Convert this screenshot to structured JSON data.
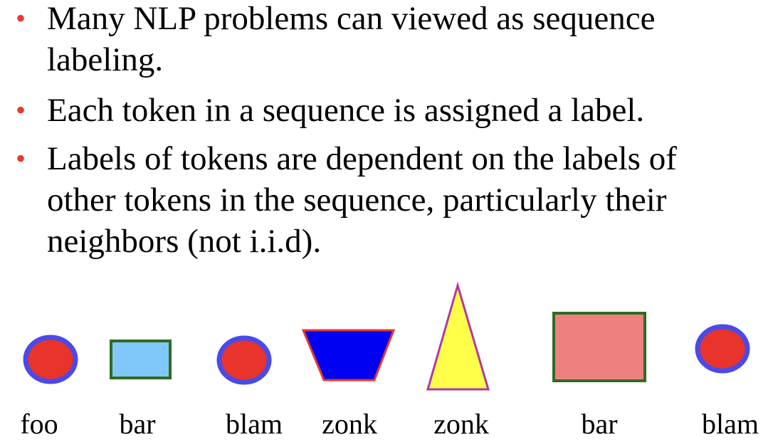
{
  "bullets": [
    {
      "text": "Many NLP problems can viewed as sequence\nlabeling."
    },
    {
      "text": "Each token in a sequence is assigned a label."
    },
    {
      "text": "Labels of tokens are dependent on the labels of\nother tokens in the sequence, particularly their\nneighbors (not i.i.d)."
    }
  ],
  "bullet_symbol": "•",
  "tokens": [
    {
      "label": "foo",
      "shape": "ellipse-icon",
      "fill": "#e8342a",
      "stroke": "#4a4ae8"
    },
    {
      "label": "bar",
      "shape": "rectangle-icon",
      "fill": "#80c8fa",
      "stroke": "#2f6b22"
    },
    {
      "label": "blam",
      "shape": "ellipse-icon",
      "fill": "#e8342a",
      "stroke": "#4a4ae8"
    },
    {
      "label": "zonk",
      "shape": "trapezoid-icon",
      "fill": "#0000f2",
      "stroke": "#e83a2a"
    },
    {
      "label": "zonk",
      "shape": "triangle-icon",
      "fill": "#ffff4a",
      "stroke": "#b03aa0"
    },
    {
      "label": "bar",
      "shape": "rectangle-icon",
      "fill": "#ee8080",
      "stroke": "#2f6b22"
    },
    {
      "label": "blam",
      "shape": "ellipse-icon",
      "fill": "#e8342a",
      "stroke": "#4a4ae8"
    }
  ]
}
